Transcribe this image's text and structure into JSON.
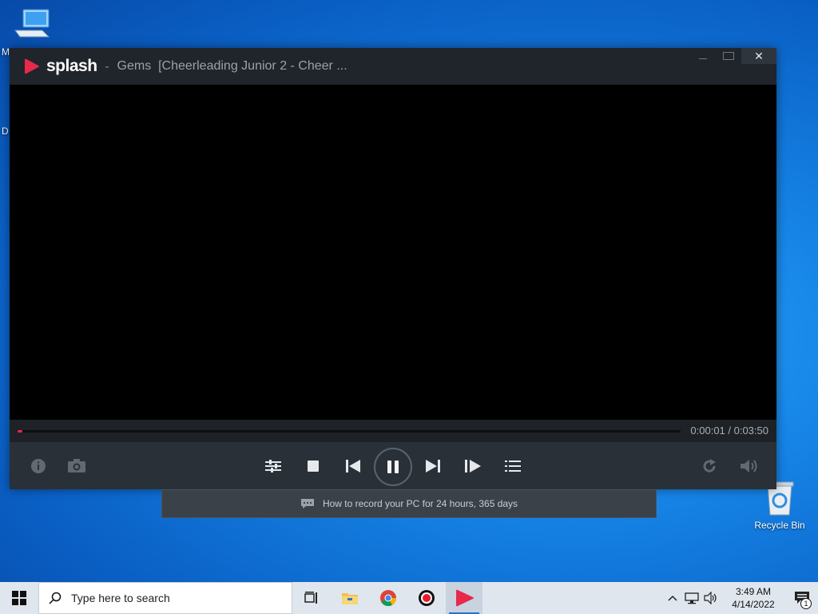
{
  "desktop": {
    "edge_letter_1": "M",
    "edge_letter_2": "D",
    "recycle_bin_label": "Recycle Bin"
  },
  "window": {
    "app_name": "splash",
    "separator": "-",
    "title": "Gems  [Cheerleading Junior 2 - Cheer ...",
    "minimize_icon": "minimize-icon",
    "maximize_icon": "maximize-icon",
    "close_label": "✕"
  },
  "player": {
    "time": "0:00:01 / 0:03:50",
    "progress": 0.007,
    "controls": [
      "info-icon",
      "screenshot-icon",
      "equalizer-icon",
      "stop-icon",
      "previous-icon",
      "pause-icon",
      "next-icon",
      "frame-step-icon",
      "playlist-icon",
      "repeat-icon",
      "volume-icon"
    ]
  },
  "notice": {
    "text": "How to record your PC for 24 hours, 365 days"
  },
  "taskbar": {
    "search_placeholder": "Type here to search",
    "apps": [
      "task-view-icon",
      "file-explorer-icon",
      "chrome-icon",
      "recorder-icon",
      "splash-icon"
    ],
    "time": "3:49 AM",
    "date": "4/14/2022",
    "notification_count": "1"
  },
  "colors": {
    "accent": "#e8294a",
    "window_bg": "#1e2227",
    "control_bar": "#2a3037"
  }
}
